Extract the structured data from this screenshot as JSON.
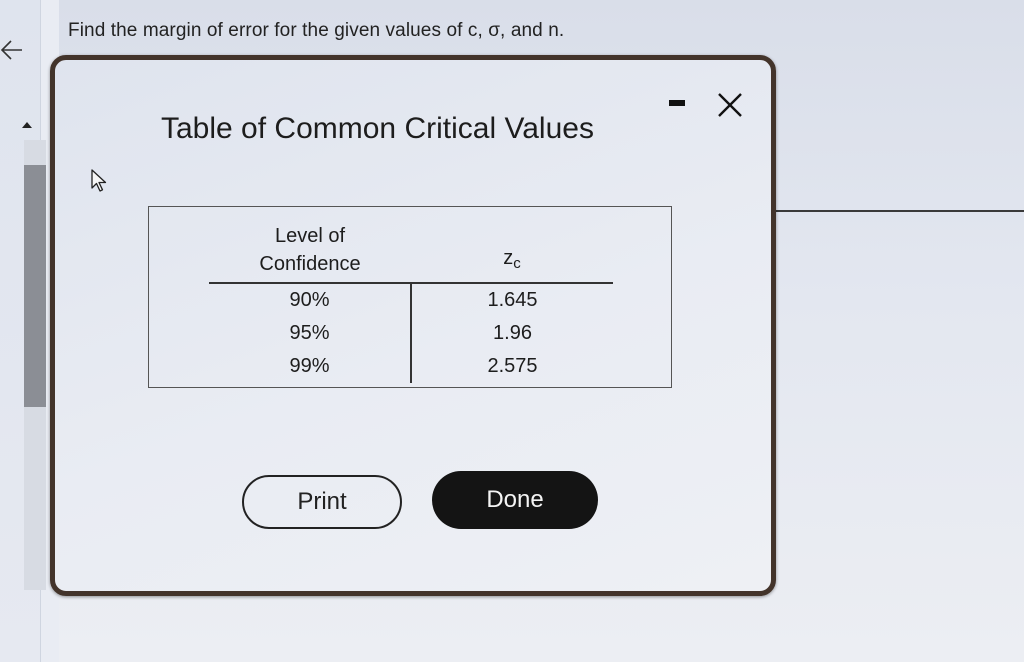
{
  "question": {
    "text": "Find the margin of error for the given values of c, σ, and n."
  },
  "dialog": {
    "title": "Table of Common Critical Values",
    "table": {
      "headers": {
        "confidence_line1": "Level of",
        "confidence_line2": "Confidence",
        "critical_value_symbol": "z",
        "critical_value_subscript": "c"
      },
      "rows": [
        {
          "confidence": "90%",
          "zc": "1.645"
        },
        {
          "confidence": "95%",
          "zc": "1.96"
        },
        {
          "confidence": "99%",
          "zc": "2.575"
        }
      ]
    },
    "buttons": {
      "print_label": "Print",
      "done_label": "Done"
    }
  },
  "icons": {
    "back": "back-arrow-icon",
    "minimize": "minimize-icon",
    "close": "close-icon",
    "cursor": "mouse-pointer-icon",
    "scroll_up": "scroll-up-arrow-icon"
  },
  "colors": {
    "dialog_border": "#43342b",
    "done_button": "#141414",
    "background": "#e3e7f0"
  }
}
